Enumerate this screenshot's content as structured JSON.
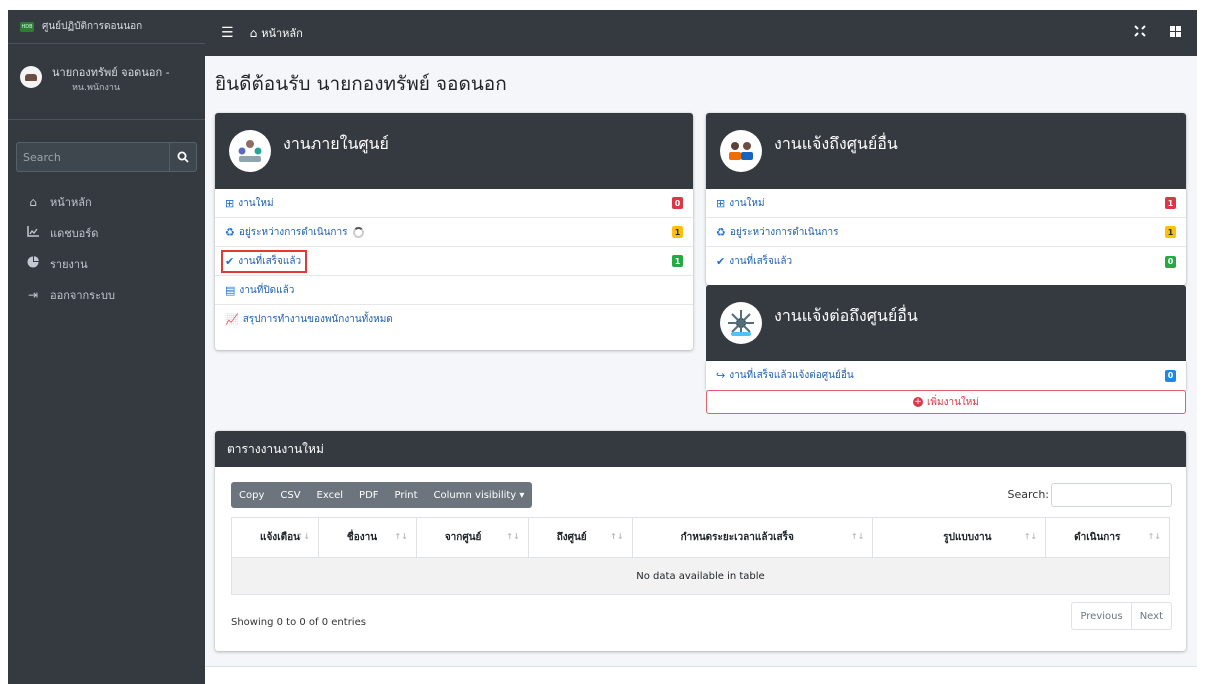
{
  "brand": {
    "logo_text": "HDB",
    "title": "ศูนย์ปฏิบัติการดอนนอก"
  },
  "user": {
    "name": "นายกองทรัพย์ จอดนอก -",
    "role": "หน.พนักงาน"
  },
  "sidebar": {
    "search_placeholder": "Search",
    "items": [
      {
        "icon": "home-icon",
        "label": "หน้าหลัก"
      },
      {
        "icon": "chart-icon",
        "label": "แดชบอร์ด"
      },
      {
        "icon": "pie-chart-icon",
        "label": "รายงาน"
      },
      {
        "icon": "sign-out-icon",
        "label": "ออกจากระบบ"
      }
    ]
  },
  "topbar": {
    "breadcrumb": "หน้าหลัก"
  },
  "welcome": "ยินดีต้อนรับ นายกองทรัพย์ จอดนอก",
  "card_internal": {
    "title": "งานภายในศูนย์",
    "rows": [
      {
        "label": "งานใหม่",
        "badge": "0",
        "color": "#dc3545"
      },
      {
        "label": "อยู่ระหว่างการดำเนินการ",
        "badge": "1",
        "color": "#ffc107"
      },
      {
        "label": "งานที่เสร็จแล้ว",
        "badge": "1",
        "color": "#28a745"
      },
      {
        "label": "งานที่ปิดแล้ว"
      },
      {
        "label": "สรุปการทำงานของพนักงานทั้งหมด"
      }
    ]
  },
  "card_other": {
    "title": "งานแจ้งถึงศูนย์อื่น",
    "rows": [
      {
        "label": "งานใหม่",
        "badge": "1",
        "color": "#dc3545"
      },
      {
        "label": "อยู่ระหว่างการดำเนินการ",
        "badge": "1",
        "color": "#ffc107"
      },
      {
        "label": "งานที่เสร็จแล้ว",
        "badge": "0",
        "color": "#28a745"
      }
    ]
  },
  "card_forward": {
    "title": "งานแจ้งต่อถึงศูนย์อื่น",
    "row_label": "งานที่เสร็จแล้วแจ้งต่อศูนย์อื่น",
    "row_badge": "0",
    "add_label": "เพิ่มงานใหม่"
  },
  "table": {
    "title": "ตารางงานงานใหม่",
    "buttons": [
      "Copy",
      "CSV",
      "Excel",
      "PDF",
      "Print",
      "Column visibility ▾"
    ],
    "search_label": "Search:",
    "columns": [
      "แจ้งเตือน",
      "ชื่องาน",
      "จากศูนย์",
      "ถึงศูนย์",
      "กำหนดระยะเวลาแล้วเสร็จ",
      "รูปแบบงาน",
      "ดำเนินการ"
    ],
    "empty_text": "No data available in table",
    "info": "Showing 0 to 0 of 0 entries",
    "prev": "Previous",
    "next": "Next"
  }
}
